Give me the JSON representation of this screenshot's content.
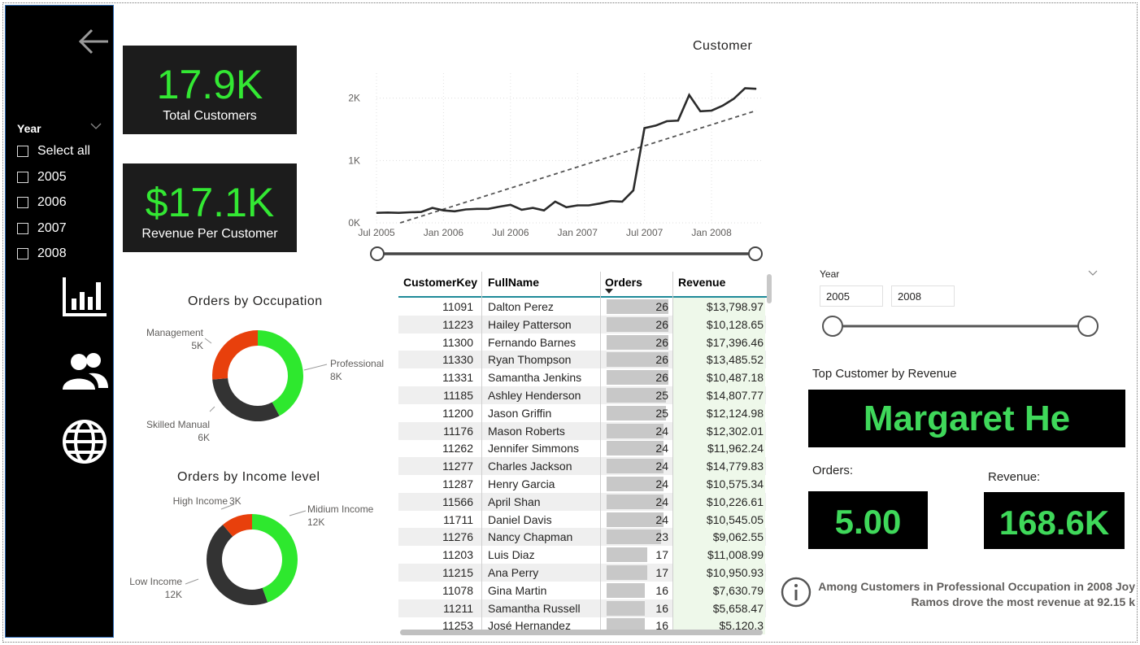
{
  "sidebar": {
    "slicer_title": "Year",
    "items": [
      {
        "label": "Select all"
      },
      {
        "label": "2005"
      },
      {
        "label": "2006"
      },
      {
        "label": "2007"
      },
      {
        "label": "2008"
      }
    ],
    "nav_icons": [
      "bar-chart-icon",
      "users-icon",
      "globe-icon"
    ]
  },
  "kpis": {
    "total_customers": {
      "value": "17.9K",
      "label": "Total Customers"
    },
    "revenue_per_customer": {
      "value": "$17.1K",
      "label": "Revenue Per Customer"
    }
  },
  "colors": {
    "kpi_green": "#33e833",
    "highlight_green": "#3fd85a",
    "donut_green": "#2ee82e",
    "donut_red": "#e8400c",
    "donut_dark": "#333333"
  },
  "chart_data": [
    {
      "type": "line",
      "title": "Customer",
      "x_ticks": [
        "Jul 2005",
        "Jan 2006",
        "Jul 2006",
        "Jan 2007",
        "Jul 2007",
        "Jan 2008"
      ],
      "y_ticks": [
        "0K",
        "1K",
        "2K"
      ],
      "ylim": [
        0,
        2400
      ],
      "x": [
        "2005-07",
        "2005-08",
        "2005-09",
        "2005-10",
        "2005-11",
        "2005-12",
        "2006-01",
        "2006-02",
        "2006-03",
        "2006-04",
        "2006-05",
        "2006-06",
        "2006-07",
        "2006-08",
        "2006-09",
        "2006-10",
        "2006-11",
        "2006-12",
        "2007-01",
        "2007-02",
        "2007-03",
        "2007-04",
        "2007-05",
        "2007-06",
        "2007-07",
        "2007-08",
        "2007-09",
        "2007-10",
        "2007-11",
        "2007-12",
        "2008-01",
        "2008-02",
        "2008-03",
        "2008-04",
        "2008-05",
        "2008-06",
        "2008-07"
      ],
      "values": [
        160,
        165,
        160,
        170,
        175,
        240,
        200,
        185,
        215,
        225,
        225,
        260,
        290,
        210,
        240,
        200,
        340,
        250,
        280,
        280,
        310,
        350,
        340,
        520,
        1520,
        1560,
        1630,
        1640,
        2050,
        1790,
        1800,
        1880,
        1990,
        2160,
        2150
      ],
      "trend": {
        "style": "dashed",
        "values": [
          -120,
          1800
        ]
      },
      "grid": true
    },
    {
      "type": "pie",
      "title": "Orders by Occupation",
      "donut": true,
      "slices": [
        {
          "label": "Professional",
          "value_label": "8K",
          "value": 8000
        },
        {
          "label": "Skilled Manual",
          "value_label": "6K",
          "value": 6000
        },
        {
          "label": "Management",
          "value_label": "5K",
          "value": 5000
        }
      ]
    },
    {
      "type": "pie",
      "title": "Orders by Income level",
      "donut": true,
      "slices": [
        {
          "label": "Midium Income",
          "value_label": "12K",
          "value": 12000
        },
        {
          "label": "Low Income",
          "value_label": "12K",
          "value": 12000
        },
        {
          "label": "High Income",
          "value_label": "3K",
          "value": 3000
        }
      ]
    }
  ],
  "table": {
    "columns": [
      "CustomerKey",
      "FullName",
      "Orders",
      "Revenue"
    ],
    "max_orders": 26,
    "rows": [
      {
        "key": "11091",
        "name": "Dalton Perez",
        "orders": 26,
        "revenue": "$13,798.97"
      },
      {
        "key": "11223",
        "name": "Hailey Patterson",
        "orders": 26,
        "revenue": "$10,128.65"
      },
      {
        "key": "11300",
        "name": "Fernando Barnes",
        "orders": 26,
        "revenue": "$17,396.46"
      },
      {
        "key": "11330",
        "name": "Ryan Thompson",
        "orders": 26,
        "revenue": "$13,485.52"
      },
      {
        "key": "11331",
        "name": "Samantha Jenkins",
        "orders": 26,
        "revenue": "$10,487.18"
      },
      {
        "key": "11185",
        "name": "Ashley Henderson",
        "orders": 25,
        "revenue": "$14,807.77"
      },
      {
        "key": "11200",
        "name": "Jason Griffin",
        "orders": 25,
        "revenue": "$12,124.98"
      },
      {
        "key": "11176",
        "name": "Mason Roberts",
        "orders": 24,
        "revenue": "$12,302.01"
      },
      {
        "key": "11262",
        "name": "Jennifer Simmons",
        "orders": 24,
        "revenue": "$11,962.24"
      },
      {
        "key": "11277",
        "name": "Charles Jackson",
        "orders": 24,
        "revenue": "$14,779.83"
      },
      {
        "key": "11287",
        "name": "Henry Garcia",
        "orders": 24,
        "revenue": "$10,575.34"
      },
      {
        "key": "11566",
        "name": "April Shan",
        "orders": 24,
        "revenue": "$10,226.61"
      },
      {
        "key": "11711",
        "name": "Daniel Davis",
        "orders": 24,
        "revenue": "$10,545.05"
      },
      {
        "key": "11276",
        "name": "Nancy Chapman",
        "orders": 23,
        "revenue": "$9,062.55"
      },
      {
        "key": "11203",
        "name": "Luis Diaz",
        "orders": 17,
        "revenue": "$11,008.99"
      },
      {
        "key": "11215",
        "name": "Ana Perry",
        "orders": 17,
        "revenue": "$10,950.93"
      },
      {
        "key": "11078",
        "name": "Gina Martin",
        "orders": 16,
        "revenue": "$7,630.79"
      },
      {
        "key": "11211",
        "name": "Samantha Russell",
        "orders": 16,
        "revenue": "$5,658.47"
      },
      {
        "key": "11253",
        "name": "José Hernandez",
        "orders": 16,
        "revenue": "$5,120.3"
      }
    ]
  },
  "year_slicer": {
    "title": "Year",
    "from": "2005",
    "to": "2008"
  },
  "top_customer": {
    "title": "Top Customer by Revenue",
    "name": "Margaret He",
    "orders_label": "Orders:",
    "orders_value": "5.00",
    "revenue_label": "Revenue:",
    "revenue_value": "168.6K"
  },
  "insight": {
    "line1": "Among Customers in Professional Occupation in 2008 Joy",
    "line2": "Ramos drove the most revenue at 92.15 k"
  }
}
